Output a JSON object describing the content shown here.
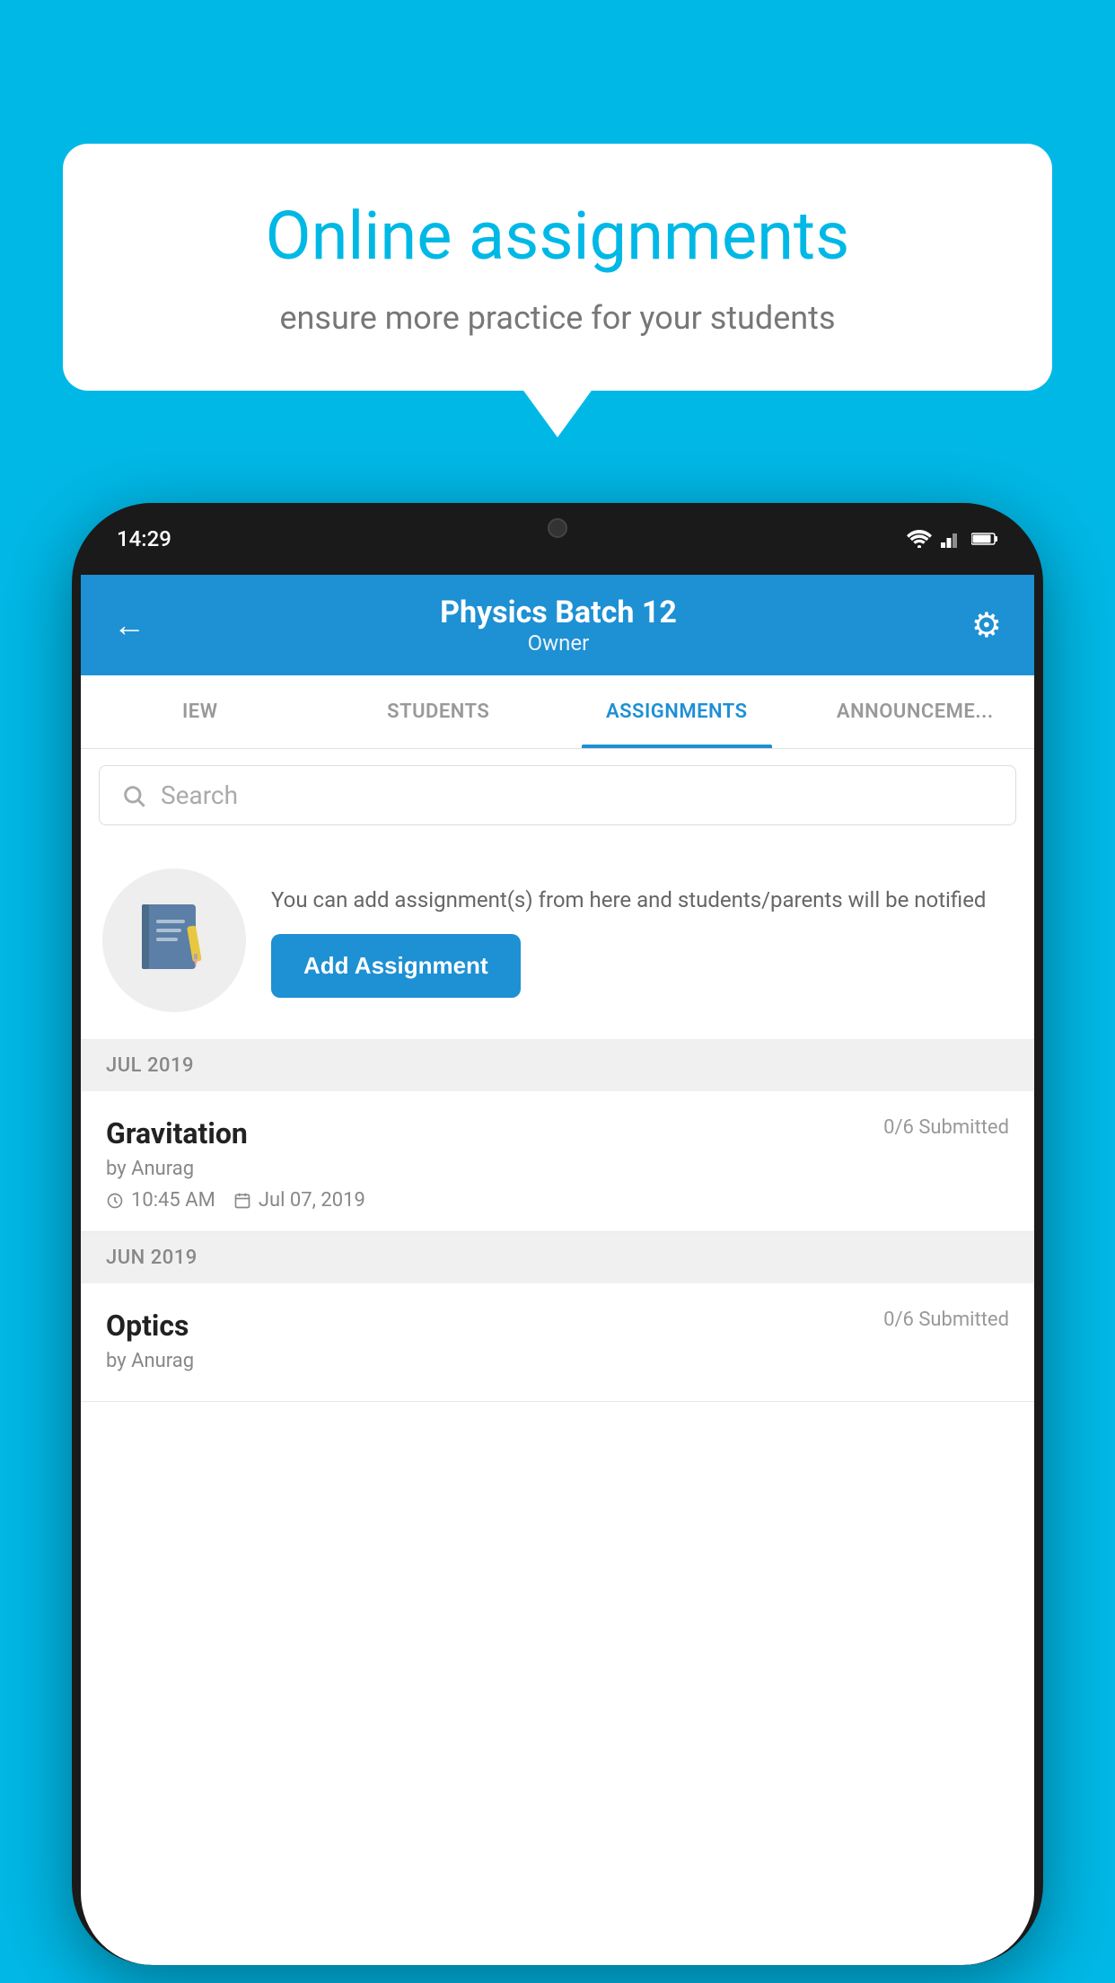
{
  "background_color": "#00b8e6",
  "speech_bubble": {
    "title": "Online assignments",
    "subtitle": "ensure more practice for your students"
  },
  "phone": {
    "status_bar": {
      "time": "14:29"
    },
    "header": {
      "title": "Physics Batch 12",
      "subtitle": "Owner"
    },
    "tabs": [
      {
        "label": "IEW",
        "active": false
      },
      {
        "label": "STUDENTS",
        "active": false
      },
      {
        "label": "ASSIGNMENTS",
        "active": true
      },
      {
        "label": "ANNOUNCEMENTS",
        "active": false
      }
    ],
    "search": {
      "placeholder": "Search"
    },
    "promo": {
      "text": "You can add assignment(s) from here and students/parents will be notified",
      "button_label": "Add Assignment"
    },
    "sections": [
      {
        "month": "JUL 2019",
        "assignments": [
          {
            "name": "Gravitation",
            "submitted": "0/6 Submitted",
            "by": "by Anurag",
            "time": "10:45 AM",
            "date": "Jul 07, 2019"
          }
        ]
      },
      {
        "month": "JUN 2019",
        "assignments": [
          {
            "name": "Optics",
            "submitted": "0/6 Submitted",
            "by": "by Anurag",
            "time": "",
            "date": ""
          }
        ]
      }
    ]
  }
}
